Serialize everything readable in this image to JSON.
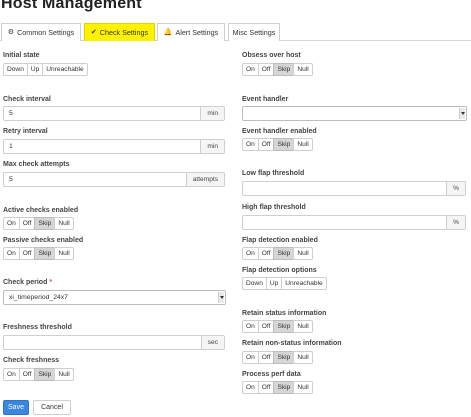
{
  "page": {
    "title": "Host Management"
  },
  "tabs": [
    {
      "label": "Common Settings",
      "icon": "gear-icon",
      "glyph": "⚙"
    },
    {
      "label": "Check Settings",
      "icon": "check-icon",
      "glyph": "✔"
    },
    {
      "label": "Alert Settings",
      "icon": "bell-icon",
      "glyph": "🔔"
    },
    {
      "label": "Misc Settings"
    }
  ],
  "left": {
    "initial_state": {
      "label": "Initial state",
      "options": [
        "Down",
        "Up",
        "Unreachable"
      ]
    },
    "check_interval": {
      "label": "Check interval",
      "value": "5",
      "unit": "min"
    },
    "retry_interval": {
      "label": "Retry interval",
      "value": "1",
      "unit": "min"
    },
    "max_check_attempts": {
      "label": "Max check attempts",
      "value": "5",
      "unit": "attempts"
    },
    "active_checks": {
      "label": "Active checks enabled",
      "options": [
        "On",
        "Off",
        "Skip",
        "Null"
      ],
      "selected": "Skip"
    },
    "passive_checks": {
      "label": "Passive checks enabled",
      "options": [
        "On",
        "Off",
        "Skip",
        "Null"
      ],
      "selected": "Skip"
    },
    "check_period": {
      "label": "Check period",
      "required": "*",
      "value": "xi_timeperiod_24x7"
    },
    "freshness_threshold": {
      "label": "Freshness threshold",
      "value": "",
      "unit": "sec"
    },
    "check_freshness": {
      "label": "Check freshness",
      "options": [
        "On",
        "Off",
        "Skip",
        "Null"
      ],
      "selected": "Skip"
    }
  },
  "right": {
    "obsess_over_host": {
      "label": "Obsess over host",
      "options": [
        "On",
        "Off",
        "Skip",
        "Null"
      ],
      "selected": "Skip"
    },
    "event_handler": {
      "label": "Event handler",
      "value": ""
    },
    "event_handler_enabled": {
      "label": "Event handler enabled",
      "options": [
        "On",
        "Off",
        "Skip",
        "Null"
      ],
      "selected": "Skip"
    },
    "low_flap_threshold": {
      "label": "Low flap threshold",
      "value": "",
      "unit": "%"
    },
    "high_flap_threshold": {
      "label": "High flap threshold",
      "value": "",
      "unit": "%"
    },
    "flap_detection_enabled": {
      "label": "Flap detection enabled",
      "options": [
        "On",
        "Off",
        "Skip",
        "Null"
      ],
      "selected": "Skip"
    },
    "flap_detection_options": {
      "label": "Flap detection options",
      "options": [
        "Down",
        "Up",
        "Unreachable"
      ]
    },
    "retain_status": {
      "label": "Retain status information",
      "options": [
        "On",
        "Off",
        "Skip",
        "Null"
      ],
      "selected": "Skip"
    },
    "retain_nonstatus": {
      "label": "Retain non-status information",
      "options": [
        "On",
        "Off",
        "Skip",
        "Null"
      ],
      "selected": "Skip"
    },
    "process_perf_data": {
      "label": "Process perf data",
      "options": [
        "On",
        "Off",
        "Skip",
        "Null"
      ],
      "selected": "Skip"
    }
  },
  "actions": {
    "save": "Save",
    "cancel": "Cancel"
  },
  "colors": {
    "primary": "#3a87e0",
    "active_tab": "#fff200",
    "selected_option": "#d6d6d6",
    "required": "#d9534f"
  }
}
